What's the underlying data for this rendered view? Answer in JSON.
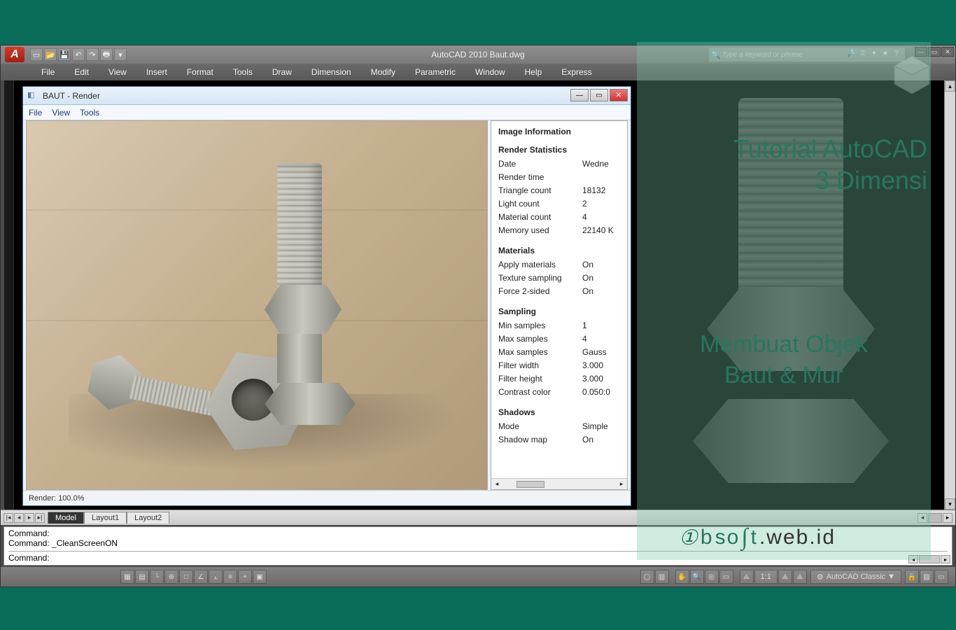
{
  "title": "AutoCAD 2010   Baut.dwg",
  "search": {
    "placeholder": "Type a keyword or phrase"
  },
  "menu": [
    "File",
    "Edit",
    "View",
    "Insert",
    "Format",
    "Tools",
    "Draw",
    "Dimension",
    "Modify",
    "Parametric",
    "Window",
    "Help",
    "Express"
  ],
  "render_window": {
    "title": "BAUT - Render",
    "menu": [
      "File",
      "View",
      "Tools"
    ],
    "status": "Render: 100.0%",
    "info_title": "Image Information",
    "sections": [
      {
        "title": "Render Statistics",
        "rows": [
          {
            "k": "Date",
            "v": "Wedne"
          },
          {
            "k": "Render time",
            "v": ""
          },
          {
            "k": "Triangle count",
            "v": "18132"
          },
          {
            "k": "Light count",
            "v": "2"
          },
          {
            "k": "Material count",
            "v": "4"
          },
          {
            "k": "Memory used",
            "v": "22140 K"
          }
        ]
      },
      {
        "title": "Materials",
        "rows": [
          {
            "k": "Apply materials",
            "v": "On"
          },
          {
            "k": "Texture sampling",
            "v": "On"
          },
          {
            "k": "Force 2-sided",
            "v": "On"
          }
        ]
      },
      {
        "title": "Sampling",
        "rows": [
          {
            "k": "Min samples",
            "v": "1"
          },
          {
            "k": "Max samples",
            "v": "4"
          },
          {
            "k": "Max samples",
            "v": "Gauss"
          },
          {
            "k": "Filter width",
            "v": "3.000"
          },
          {
            "k": "Filter height",
            "v": "3.000"
          },
          {
            "k": "Contrast color",
            "v": "0.050:0"
          }
        ]
      },
      {
        "title": "Shadows",
        "rows": [
          {
            "k": "Mode",
            "v": "Simple"
          },
          {
            "k": "Shadow map",
            "v": "On"
          }
        ]
      }
    ]
  },
  "tabs": {
    "active": "Model",
    "others": [
      "Layout1",
      "Layout2"
    ]
  },
  "command": {
    "lines": [
      "Command:",
      "Command: _CleanScreenON"
    ],
    "prompt": "Command:"
  },
  "status_workspace": "AutoCAD Classic ▼",
  "status_scale": "1:1",
  "overlay": {
    "line1": "Tutorial AutoCAD",
    "line2": "3 Dimensi",
    "line3": "Membuat Objek",
    "line4": "Baut & Mur",
    "brand_b": "b",
    "brand_so": "so",
    "brand_t": "t",
    "brand_domain": ".web.id"
  }
}
